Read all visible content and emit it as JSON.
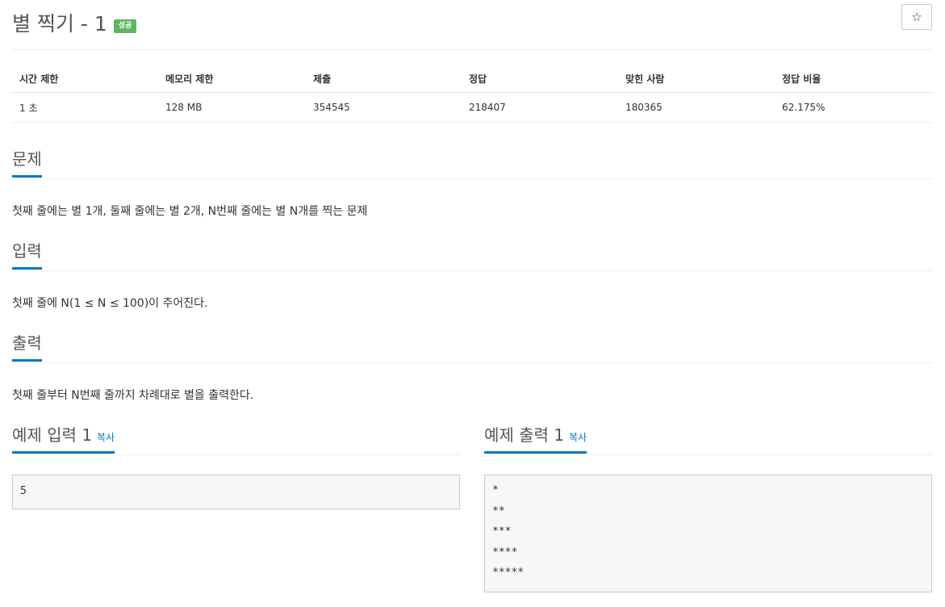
{
  "problem": {
    "title": "별 찍기 - 1",
    "status_badge": "성공",
    "star_icon": "☆"
  },
  "info_table": {
    "headers": [
      "시간 제한",
      "메모리 제한",
      "제출",
      "정답",
      "맞힌 사람",
      "정답 비율"
    ],
    "values": [
      "1 초",
      "128 MB",
      "354545",
      "218407",
      "180365",
      "62.175%"
    ]
  },
  "sections": {
    "description": {
      "title": "문제",
      "text": "첫째 줄에는 별 1개, 둘째 줄에는 별 2개, N번째 줄에는 별 N개를 찍는 문제"
    },
    "input": {
      "title": "입력",
      "text": "첫째 줄에 N(1 ≤ N ≤ 100)이 주어진다."
    },
    "output": {
      "title": "출력",
      "text": "첫째 줄부터 N번째 줄까지 차례대로 별을 출력한다."
    }
  },
  "samples": {
    "input": {
      "title": "예제 입력 1",
      "copy_label": "복사",
      "content": "5"
    },
    "output": {
      "title": "예제 출력 1",
      "copy_label": "복사",
      "content": "*\n**\n***\n****\n*****"
    }
  },
  "colors": {
    "accent": "#0076c0",
    "badge": "#5cb85c"
  }
}
